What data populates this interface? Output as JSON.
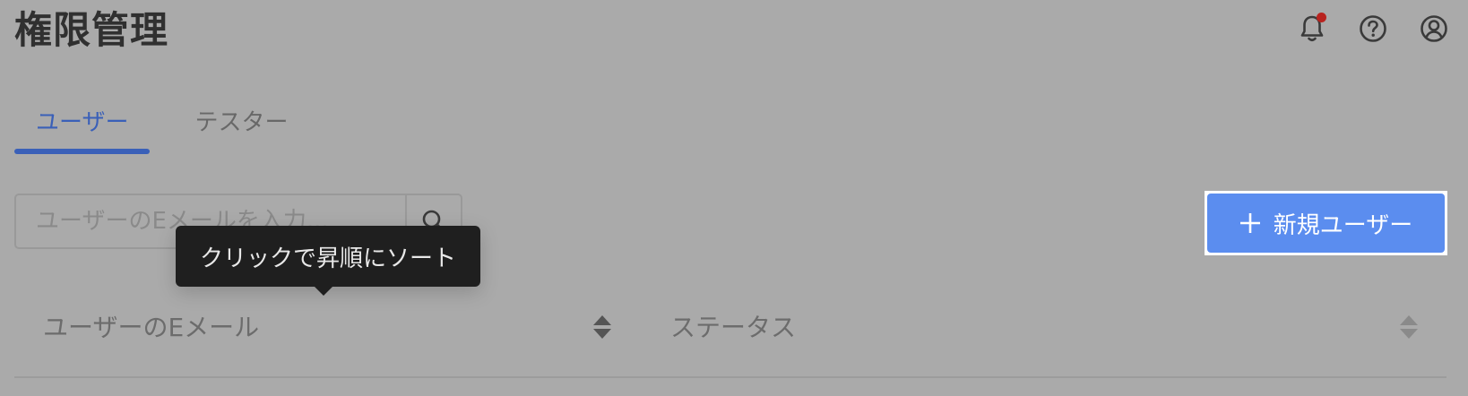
{
  "header": {
    "title": "権限管理",
    "icons": [
      "bell-icon",
      "help-circle-icon",
      "user-circle-icon"
    ],
    "notification_dot_color": "#b8231f"
  },
  "tabs": [
    {
      "label": "ユーザー",
      "active": true
    },
    {
      "label": "テスター",
      "active": false
    }
  ],
  "search": {
    "placeholder": "ユーザーのEメールを入力...",
    "value": ""
  },
  "new_user_button": {
    "icon": "plus-icon",
    "label": "新規ユーザー"
  },
  "table": {
    "columns": [
      {
        "label": "ユーザーのEメール",
        "sortable": true
      },
      {
        "label": "ステータス",
        "sortable": true
      }
    ]
  },
  "tooltip": {
    "text": "クリックで昇順にソート"
  },
  "colors": {
    "accent": "#3a60b8",
    "primary_button": "#5b8def",
    "overlay_background": "#aaaaaa",
    "tooltip_background": "#1f1f1f"
  }
}
